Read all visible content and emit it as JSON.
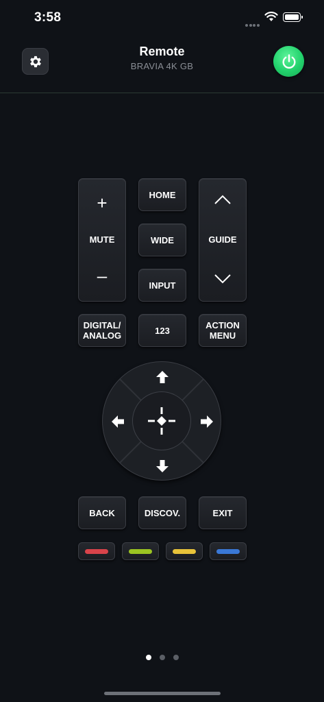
{
  "status": {
    "time": "3:58"
  },
  "header": {
    "title": "Remote",
    "subtitle": "BRAVIA 4K GB"
  },
  "keys": {
    "volume_up": "+",
    "mute": "MUTE",
    "volume_down": "–",
    "home": "HOME",
    "wide": "WIDE",
    "input": "INPUT",
    "guide": "GUIDE",
    "digital_analog_1": "DIGITAL/",
    "digital_analog_2": "ANALOG",
    "num_123": "123",
    "action_menu_1": "ACTION",
    "action_menu_2": "MENU",
    "back": "BACK",
    "discover": "DISCOV.",
    "exit": "EXIT"
  },
  "color_keys": [
    "#d9434a",
    "#9bc422",
    "#e8c33a",
    "#3a78d6"
  ],
  "colors": {
    "background": "#0f1217",
    "power": "#22d16c",
    "key": "#22252b"
  },
  "pager": {
    "pages": 3,
    "active": 1
  }
}
